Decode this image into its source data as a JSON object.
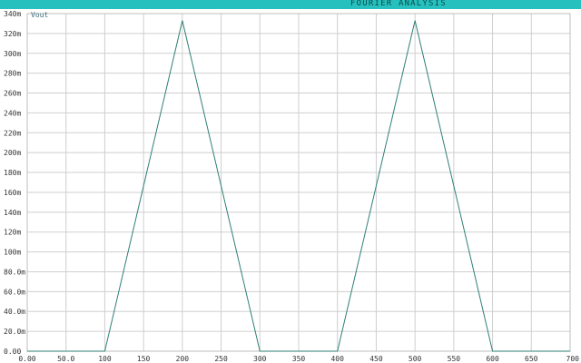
{
  "window": {
    "title": "FOURIER ANALYSIS"
  },
  "colors": {
    "titlebar": "#26c1bf",
    "grid": "#cfcfcf",
    "trace": "#2f7f75"
  },
  "chart_data": {
    "type": "line",
    "title": "FOURIER ANALYSIS",
    "xlim": [
      0,
      700
    ],
    "ylim": [
      0,
      340
    ],
    "y_unit_note": "m",
    "grid": true,
    "x_ticks": [
      0,
      50,
      100,
      150,
      200,
      250,
      300,
      350,
      400,
      450,
      500,
      550,
      600,
      650,
      700
    ],
    "x_tick_labels": [
      "0.00",
      "50.0",
      "100",
      "150",
      "200",
      "250",
      "300",
      "350",
      "400",
      "450",
      "500",
      "550",
      "600",
      "650",
      "700"
    ],
    "y_ticks": [
      0,
      20,
      40,
      60,
      80,
      100,
      120,
      140,
      160,
      180,
      200,
      220,
      240,
      260,
      280,
      300,
      320,
      340
    ],
    "y_tick_labels": [
      "0.00",
      "20.0m",
      "40.0m",
      "60.0m",
      "80.0m",
      "100m",
      "120m",
      "140m",
      "160m",
      "180m",
      "200m",
      "220m",
      "240m",
      "260m",
      "280m",
      "300m",
      "320m",
      "340m"
    ],
    "series": [
      {
        "name": "Vout",
        "x": [
          0,
          100,
          200,
          300,
          400,
          500,
          600,
          700
        ],
        "y": [
          0,
          0,
          333,
          0,
          0,
          333,
          0,
          0
        ]
      }
    ]
  }
}
